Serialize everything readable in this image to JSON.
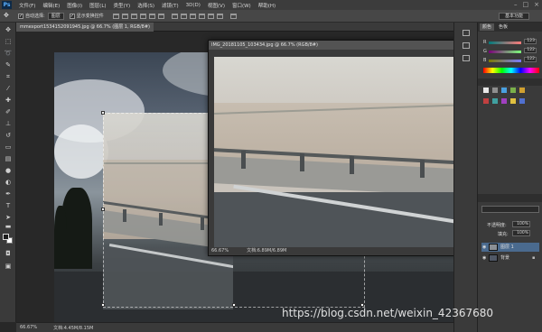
{
  "app": {
    "logo": "Ps"
  },
  "menu": [
    "文件(F)",
    "编辑(E)",
    "图像(I)",
    "图层(L)",
    "类型(Y)",
    "选择(S)",
    "滤镜(T)",
    "3D(D)",
    "视图(V)",
    "窗口(W)",
    "帮助(H)"
  ],
  "window_controls": {
    "minimize": "–",
    "maximize": "□",
    "close": "×"
  },
  "options": {
    "move_tool_icon": "move-icon",
    "auto_select_label": "自动选择:",
    "auto_select_value": "图层",
    "transform_controls_label": "显示变换控件",
    "workspace": "基本功能"
  },
  "document": {
    "tab_title": "mmexport1534152091945.jpg @ 66.7% (图层 1, RGB/8#)",
    "zoom": "66.67%",
    "doc_size": "文档:4.45M/8.15M"
  },
  "floating_doc": {
    "title": "IMG_20181105_103434.jpg @ 66.7% (RGB/8#)",
    "zoom": "66.67%",
    "doc_size": "文档:6.89M/6.89M"
  },
  "color_panel": {
    "tabs": [
      "颜色",
      "色板"
    ],
    "channels": [
      {
        "label": "R",
        "value": "123"
      },
      {
        "label": "G",
        "value": "122"
      },
      {
        "label": "B",
        "value": "122"
      }
    ]
  },
  "layers_panel": {
    "opacity_label": "不透明度:",
    "opacity_value": "100%",
    "fill_label": "填充:",
    "fill_value": "100%",
    "layers": [
      {
        "name": "图层 1",
        "selected": true
      },
      {
        "name": "背景",
        "selected": false
      }
    ]
  },
  "watermark": "https://blog.csdn.net/weixin_42367680",
  "colors": {
    "accent": "#1e78d7",
    "panel": "#3a3a3a",
    "canvas_bg": "#282828"
  }
}
